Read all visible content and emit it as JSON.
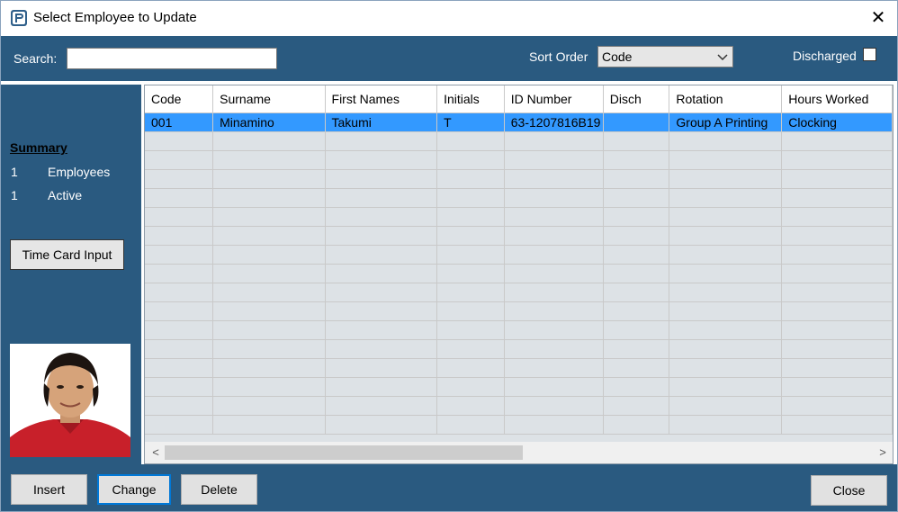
{
  "window": {
    "title": "Select Employee to Update"
  },
  "toolbar": {
    "search_label": "Search:",
    "search_value": "",
    "sort_label": "Sort Order",
    "sort_value": "Code",
    "discharged_label": "Discharged",
    "discharged_checked": false
  },
  "sidebar": {
    "summary_title": "Summary",
    "employees_count": "1",
    "employees_label": "Employees",
    "active_count": "1",
    "active_label": "Active",
    "time_card_button": "Time Card Input"
  },
  "grid": {
    "columns": [
      "Code",
      "Surname",
      "First Names",
      "Initials",
      "ID Number",
      "Disch",
      "Rotation",
      "Hours Worked"
    ],
    "rows": [
      [
        "001",
        "Minamino",
        "Takumi",
        "T",
        "63-1207816B19",
        "",
        "Group A Printing",
        "Clocking"
      ]
    ],
    "selected_row": 0
  },
  "buttons": {
    "insert": "Insert",
    "change": "Change",
    "delete": "Delete",
    "close": "Close"
  },
  "colors": {
    "panel": "#2a5a80",
    "selection": "#3399ff",
    "grid_bg": "#dde2e6"
  }
}
